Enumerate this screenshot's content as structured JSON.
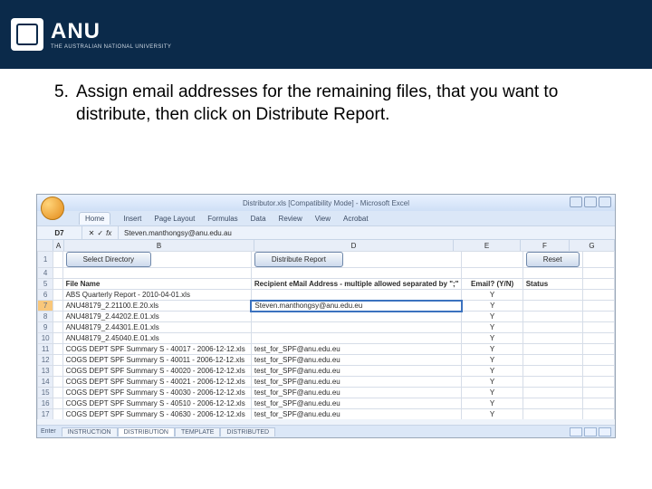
{
  "university": {
    "abbr": "ANU",
    "full": "THE AUSTRALIAN NATIONAL UNIVERSITY"
  },
  "instruction": {
    "number": "5.",
    "text": "Assign email addresses for the remaining files, that you want to distribute, then click on Distribute Report."
  },
  "window_title": "Distributor.xls  [Compatibility Mode]  -  Microsoft Excel",
  "ribbon_tabs": [
    "Home",
    "Insert",
    "Page Layout",
    "Formulas",
    "Data",
    "Review",
    "View",
    "Acrobat"
  ],
  "name_box": "D7",
  "formula_value": "Steven.manthongsy@anu.edu.au",
  "col_headers": [
    "A",
    "B",
    "D",
    "E",
    "F",
    "G"
  ],
  "buttons": {
    "select_dir": "Select Directory",
    "distribute": "Distribute Report",
    "reset": "Reset"
  },
  "table_headers": {
    "file": "File Name",
    "recipient": "Recipient eMail Address - multiple allowed separated by \";\"",
    "email_yn": "Email? (Y/N)",
    "status": "Status"
  },
  "rows": [
    {
      "n": "6",
      "file": "ABS Quarterly Report - 2010-04-01.xls",
      "recip": "",
      "yn": "Y"
    },
    {
      "n": "7",
      "file": "ANU48179_2.21100.E.20.xls",
      "recip": "Steven.manthongsy@anu.edu.eu",
      "yn": "Y",
      "editing": true
    },
    {
      "n": "8",
      "file": "ANU48179_2.44202.E.01.xls",
      "recip": "",
      "yn": "Y"
    },
    {
      "n": "9",
      "file": "ANU48179_2.44301.E.01.xls",
      "recip": "",
      "yn": "Y"
    },
    {
      "n": "10",
      "file": "ANU48179_2.45040.E.01.xls",
      "recip": "",
      "yn": "Y"
    },
    {
      "n": "11",
      "file": "COGS DEPT SPF Summary S - 40017 - 2006-12-12.xls",
      "recip": "test_for_SPF@anu.edu.eu",
      "yn": "Y"
    },
    {
      "n": "12",
      "file": "COGS DEPT SPF Summary S - 40011 - 2006-12-12.xls",
      "recip": "test_for_SPF@anu.edu.eu",
      "yn": "Y"
    },
    {
      "n": "13",
      "file": "COGS DEPT SPF Summary S - 40020 - 2006-12-12.xls",
      "recip": "test_for_SPF@anu.edu.eu",
      "yn": "Y"
    },
    {
      "n": "14",
      "file": "COGS DEPT SPF Summary S - 40021 - 2006-12-12.xls",
      "recip": "test_for_SPF@anu.edu.eu",
      "yn": "Y"
    },
    {
      "n": "15",
      "file": "COGS DEPT SPF Summary S - 40030 - 2006-12-12.xls",
      "recip": "test_for_SPF@anu.edu.eu",
      "yn": "Y"
    },
    {
      "n": "16",
      "file": "COGS DEPT SPF Summary S - 40510 - 2006-12-12.xls",
      "recip": "test_for_SPF@anu.edu.eu",
      "yn": "Y"
    },
    {
      "n": "17",
      "file": "COGS DEPT SPF Summary S - 40630 - 2006-12-12.xls",
      "recip": "test_for_SPF@anu.edu.eu",
      "yn": "Y"
    }
  ],
  "sheet_tabs": [
    "INSTRUCTION",
    "DISTRIBUTION",
    "TEMPLATE",
    "DISTRIBUTED"
  ],
  "active_sheet": 1,
  "status_left": "Enter"
}
